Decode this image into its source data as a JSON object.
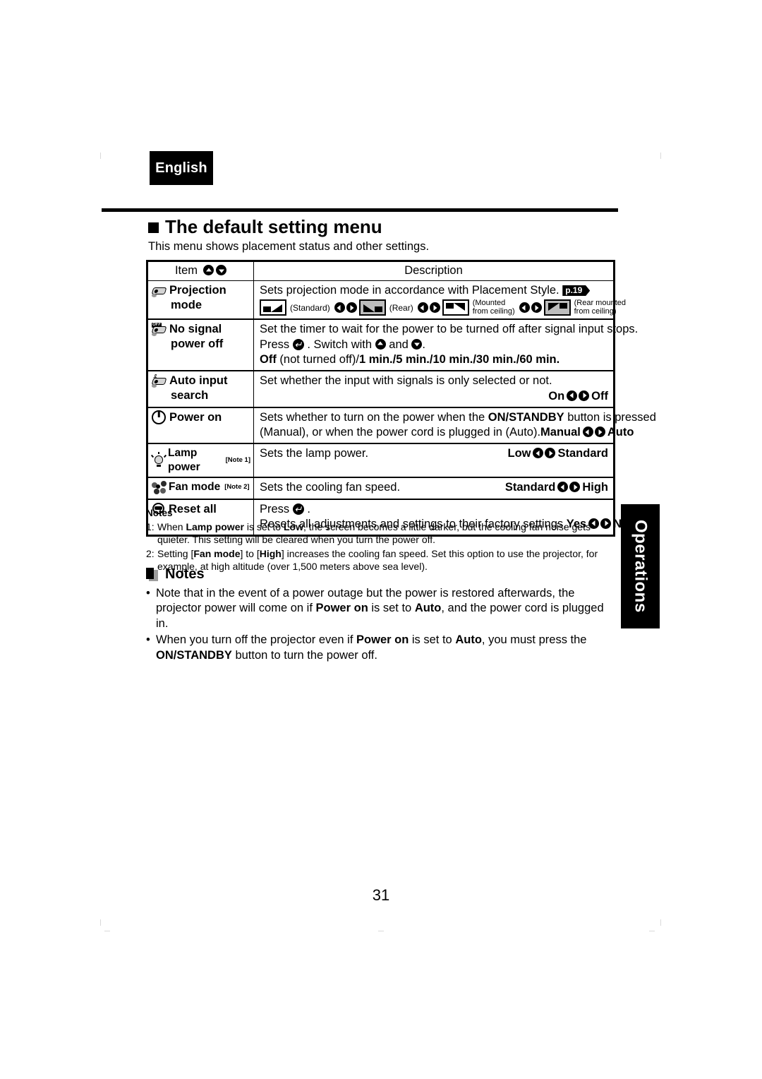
{
  "language_tab": "English",
  "section": {
    "title": "The default setting menu",
    "subtitle": "This menu shows placement status and other settings."
  },
  "table": {
    "headers": {
      "item": "Item",
      "description": "Description"
    },
    "rows": [
      {
        "item_line1": "Projection",
        "item_line2": "mode",
        "icon": "projector-icon",
        "desc_line1": "Sets projection mode in accordance with Placement Style.",
        "page_ref": "p.19",
        "placement_options": [
          {
            "icon": "screen-standard-icon",
            "label": "(Standard)"
          },
          {
            "icon": "screen-rear-icon",
            "label": "(Rear)"
          },
          {
            "icon": "screen-ceiling-icon",
            "label_line1": "(Mounted",
            "label_line2": "from ceiling)"
          },
          {
            "icon": "screen-rear-ceiling-icon",
            "label_line1": "(Rear mounted",
            "label_line2": "from ceiling)"
          }
        ]
      },
      {
        "item_line1": "No signal",
        "item_line2": "power off",
        "icon": "projector-off-icon",
        "desc_line1": "Set the timer to wait for the power to be turned off after signal input stops.",
        "desc_line2_a": "Press",
        "desc_line2_b": ". Switch with",
        "desc_line2_c": "and",
        "desc_line2_d": ".",
        "desc_line3_bold1": "Off",
        "desc_line3_plain": " (not turned off)/",
        "desc_line3_bold2": "1 min./5 min./10 min./30 min./60 min."
      },
      {
        "item_line1": "Auto input",
        "item_line2": "search",
        "icon": "projector-search-icon",
        "desc_line1": "Set whether the input with signals is only selected or not.",
        "option_left": "On",
        "option_right": "Off"
      },
      {
        "item_line1": "Power on",
        "icon": "power-icon",
        "desc_line1_a": "Sets whether to turn on the power when the ",
        "desc_line1_bold": "ON/STANDBY",
        "desc_line1_b": " button is pressed",
        "desc_line2": "(Manual), or when the power cord is plugged in (Auto).",
        "option_left": "Manual",
        "option_right": "Auto"
      },
      {
        "item_line1": "Lamp power",
        "item_note": "[Note 1]",
        "icon": "lamp-icon",
        "desc_line1": "Sets the lamp power.",
        "option_left": "Low",
        "option_right": "Standard"
      },
      {
        "item_line1": "Fan mode",
        "item_note": "[Note 2]",
        "icon": "fan-icon",
        "desc_line1": "Sets the cooling fan speed.",
        "option_left": "Standard",
        "option_right": "High"
      },
      {
        "item_line1": "Reset all",
        "icon": "reset-icon",
        "desc_line1_a": "Press",
        "desc_line1_b": ".",
        "desc_line2": "Resets all adjustments and settings to their factory settings.",
        "option_left": "Yes",
        "option_right": "No"
      }
    ]
  },
  "numbered_notes": {
    "heading": "Notes",
    "items": [
      {
        "num": "1:",
        "seg1": "When ",
        "bold1": "Lamp power",
        "seg2": " is set to ",
        "bold2": "Low",
        "seg3": ", the screen becomes a little darker, but the cooling fan noise gets quieter. This setting will be cleared when you turn the power off."
      },
      {
        "num": "2:",
        "seg1": "Setting [",
        "bold1": "Fan mode",
        "seg2": "] to [",
        "bold2": "High",
        "seg3": "] increases the cooling fan speed.  Set this option to use the projector, for example, at high altitude (over 1,500 meters above sea level)."
      }
    ]
  },
  "notes_block": {
    "heading": "Notes",
    "icon": "note-square-icon",
    "bullets": [
      {
        "bullet": "•",
        "seg1": "Note that in the event of a power outage but the power is restored afterwards, the projector power will come on if ",
        "bold1": "Power on",
        "seg2": " is set to ",
        "bold2": "Auto",
        "seg3": ", and the power cord is plugged in."
      },
      {
        "bullet": "•",
        "seg1": "When you turn off the projector even if ",
        "bold1": "Power on",
        "seg2": " is set to ",
        "bold2": "Auto",
        "seg3": ", you must press the ",
        "bold3": "ON/STANDBY",
        "seg4": " button to turn the power off."
      }
    ]
  },
  "side_tab": "Operations",
  "page_number": "31",
  "colors": {
    "ink": "#000000",
    "paper": "#ffffff",
    "grey_icon": "#9d9d9d"
  }
}
